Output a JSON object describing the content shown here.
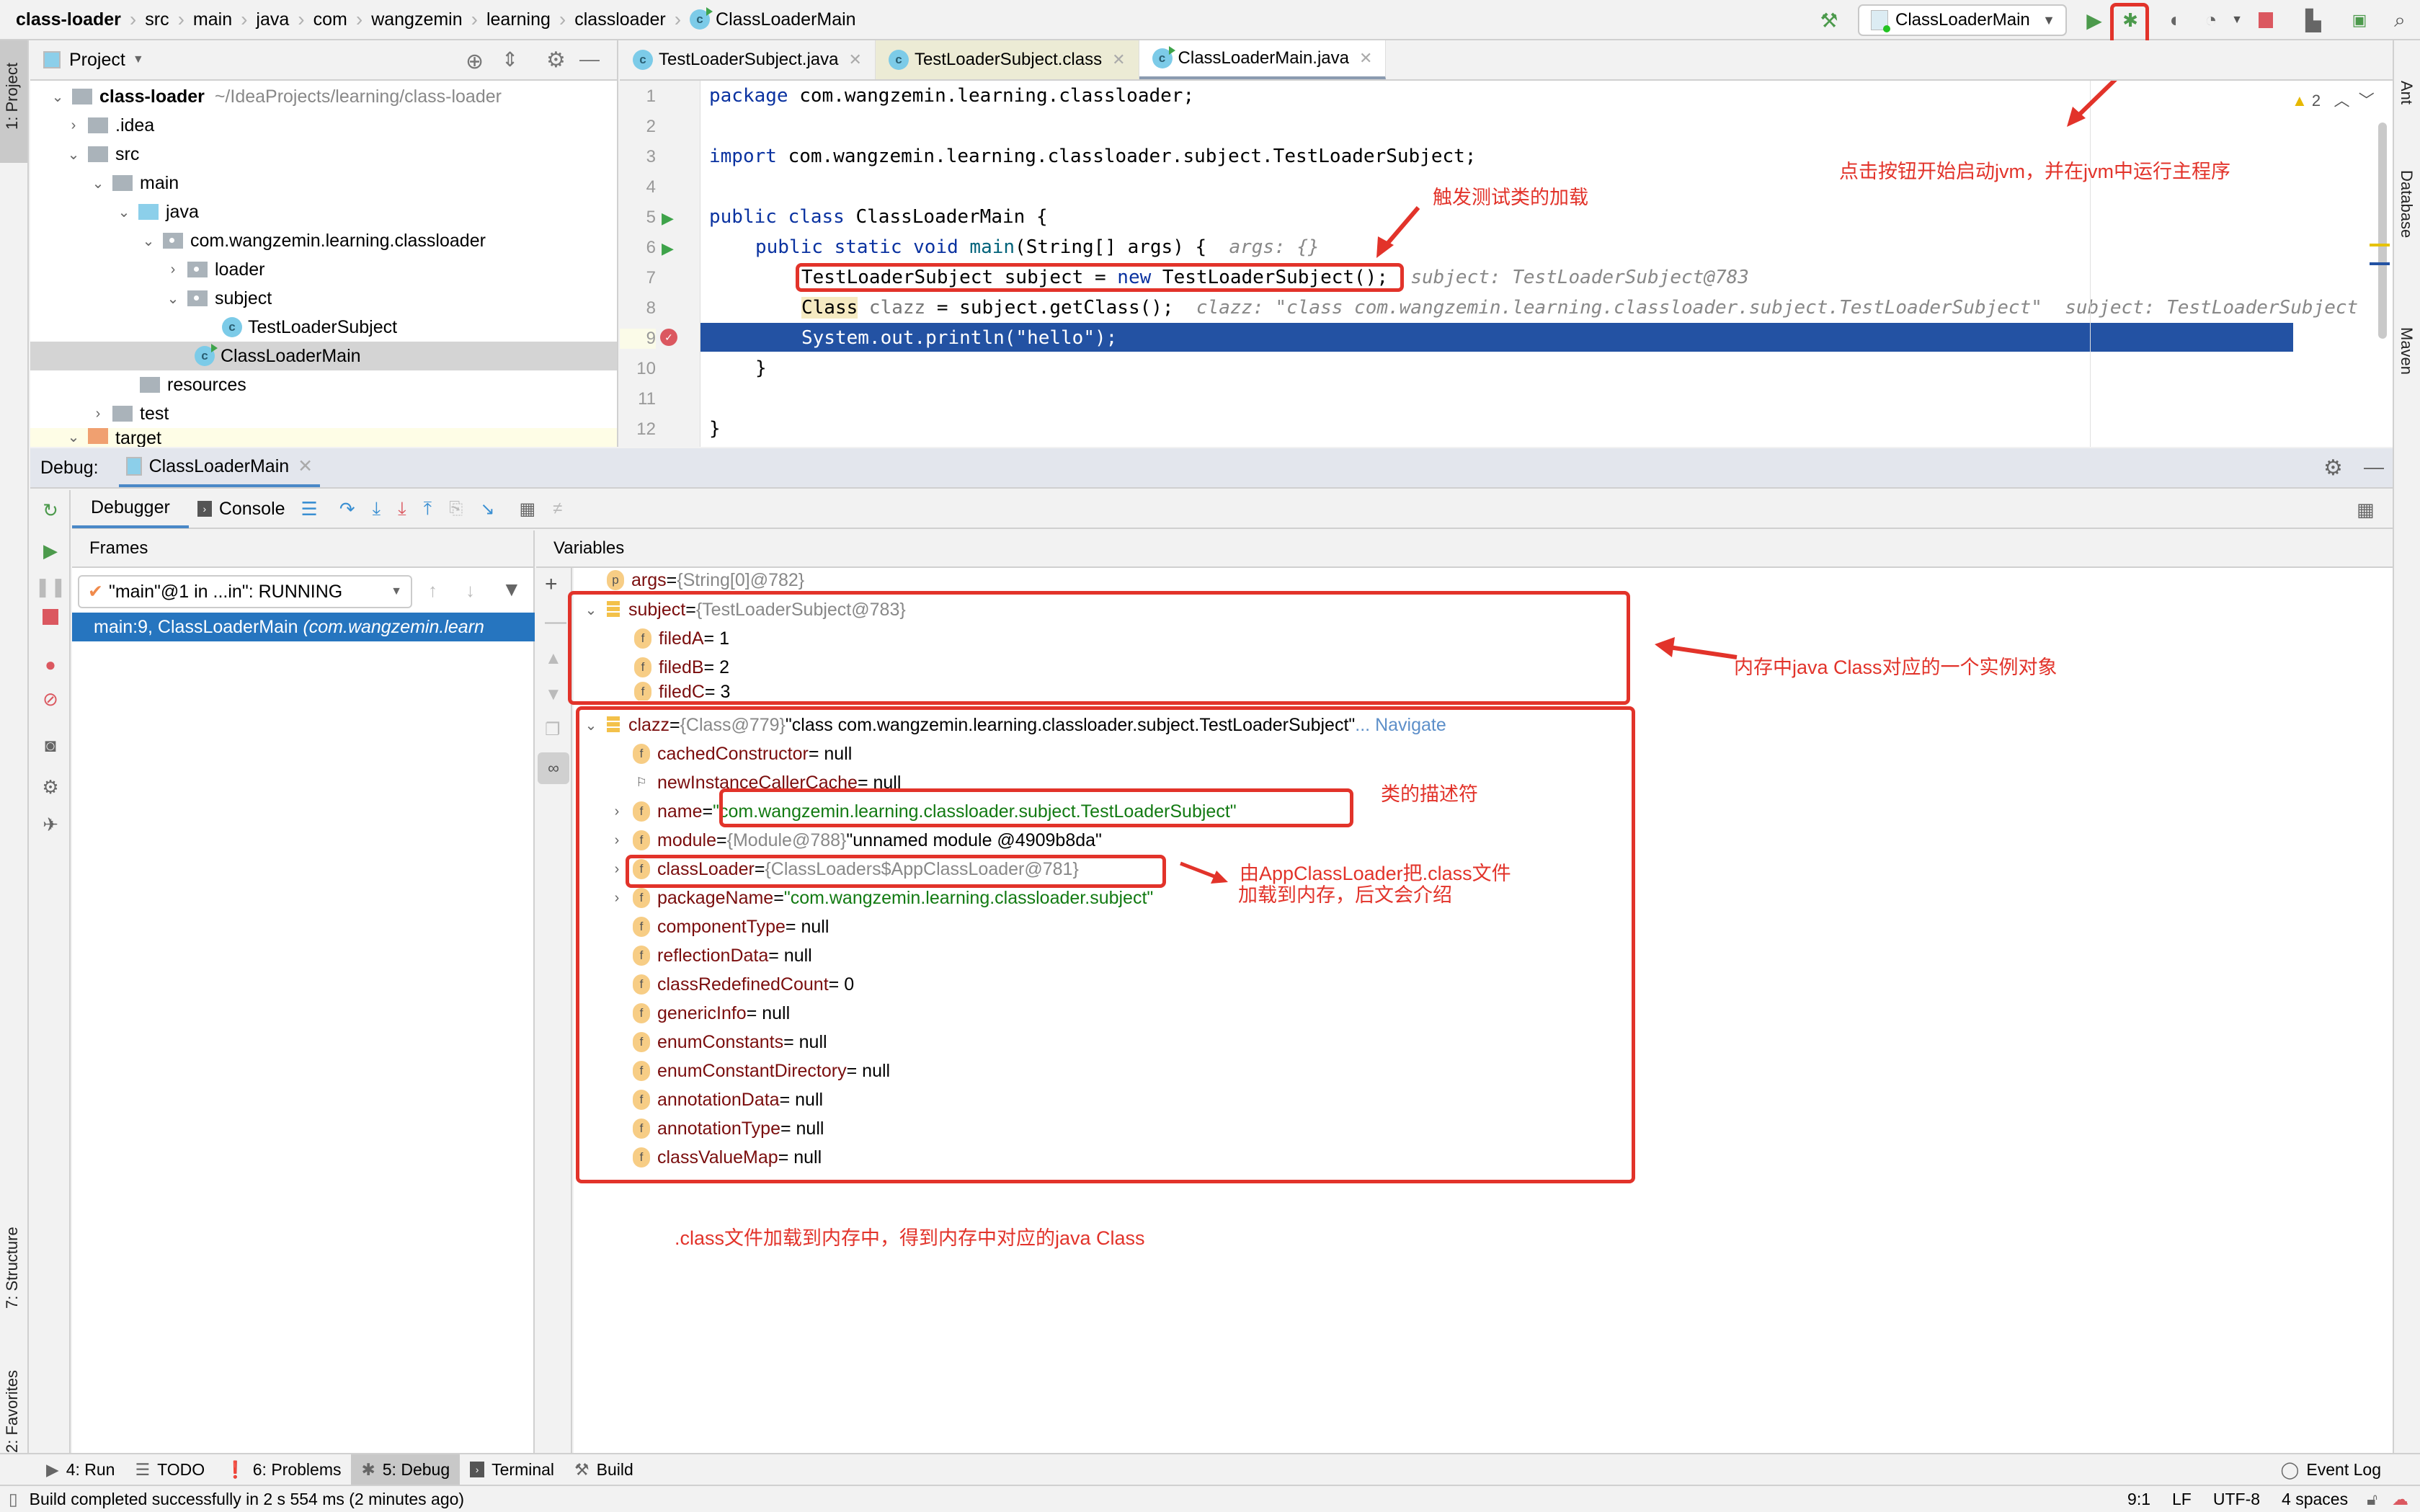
{
  "breadcrumb": [
    "class-loader",
    "src",
    "main",
    "java",
    "com",
    "wangzemin",
    "learning",
    "classloader",
    "ClassLoaderMain"
  ],
  "toolbar": {
    "run_config": "ClassLoaderMain"
  },
  "left_strip": {
    "project_tab": "1: Project",
    "structure_tab": "7: Structure",
    "favorites_tab": "2: Favorites"
  },
  "right_strip": {
    "ant": "Ant",
    "database": "Database",
    "maven": "Maven"
  },
  "project": {
    "title": "Project",
    "root_name": "class-loader",
    "root_path": "~/IdeaProjects/learning/class-loader",
    "items": [
      ".idea",
      "src",
      "main",
      "java",
      "com.wangzemin.learning.classloader",
      "loader",
      "subject",
      "TestLoaderSubject",
      "ClassLoaderMain",
      "resources",
      "test",
      "target"
    ]
  },
  "editor": {
    "tabs": [
      "TestLoaderSubject.java",
      "TestLoaderSubject.class",
      "ClassLoaderMain.java"
    ],
    "warnings": "2",
    "line_numbers": [
      "1",
      "2",
      "3",
      "4",
      "5",
      "6",
      "7",
      "8",
      "9",
      "10",
      "11",
      "12"
    ],
    "lines": {
      "l1_kw": "package",
      "l1": " com.wangzemin.learning.classloader;",
      "l3_kw": "import",
      "l3": " com.wangzemin.learning.classloader.subject.TestLoaderSubject;",
      "l5_kw": "public class",
      "l5": " ClassLoaderMain {",
      "l6_kw": "public static void",
      "l6_fn": " main",
      "l6": "(String[] args) {",
      "l6_hint": "args: {}",
      "l7_a": "TestLoaderSubject subject = ",
      "l7_kw": "new",
      "l7_b": " TestLoaderSubject();",
      "l7_hint": "subject: TestLoaderSubject@783",
      "l8_cls": "Class",
      "l8_var": " clazz",
      "l8": " = subject.getClass();",
      "l8_hint": "clazz: \"class com.wangzemin.learning.classloader.subject.TestLoaderSubject\"",
      "l8_hint2": "subject: TestLoaderSubject",
      "l9": "System.out.println(\"hello\");",
      "l10": "}",
      "l12": "}"
    }
  },
  "debug": {
    "label": "Debug:",
    "session": "ClassLoaderMain",
    "tabs": {
      "debugger": "Debugger",
      "console": "Console"
    },
    "frames_title": "Frames",
    "variables_title": "Variables",
    "thread": "\"main\"@1 in ...in\": RUNNING",
    "frame": "main:9, ClassLoaderMain",
    "frame_pkg": "(com.wangzemin.learn",
    "variables": {
      "args": {
        "name": "args",
        "eq": " = ",
        "ref": "{String[0]@782}"
      },
      "subject": {
        "name": "subject",
        "eq": " = ",
        "ref": "{TestLoaderSubject@783}"
      },
      "filedA": {
        "name": "filedA",
        "val": " = 1"
      },
      "filedB": {
        "name": "filedB",
        "val": " = 2"
      },
      "filedC": {
        "name": "filedC",
        "val": " = 3"
      },
      "clazz": {
        "name": "clazz",
        "eq": " = ",
        "ref": "{Class@779}",
        "val": " \"class com.wangzemin.learning.classloader.subject.TestLoaderSubject\"",
        "link": " ... Navigate"
      },
      "fields": [
        {
          "name": "cachedConstructor",
          "val": " = null"
        },
        {
          "name": "newInstanceCallerCache",
          "val": " = null"
        },
        {
          "name": "name",
          "eq": " = ",
          "str": "\"com.wangzemin.learning.classloader.subject.TestLoaderSubject\""
        },
        {
          "name": "module",
          "eq": " = ",
          "ref": "{Module@788}",
          "val": " \"unnamed module @4909b8da\""
        },
        {
          "name": "classLoader",
          "eq": " = ",
          "ref": "{ClassLoaders$AppClassLoader@781}"
        },
        {
          "name": "packageName",
          "eq": " = ",
          "str": "\"com.wangzemin.learning.classloader.subject\""
        },
        {
          "name": "componentType",
          "val": " = null"
        },
        {
          "name": "reflectionData",
          "val": " = null"
        },
        {
          "name": "classRedefinedCount",
          "val": " = 0"
        },
        {
          "name": "genericInfo",
          "val": " = null"
        },
        {
          "name": "enumConstants",
          "val": " = null"
        },
        {
          "name": "enumConstantDirectory",
          "val": " = null"
        },
        {
          "name": "annotationData",
          "val": " = null"
        },
        {
          "name": "annotationType",
          "val": " = null"
        },
        {
          "name": "classValueMap",
          "val": " = null"
        }
      ]
    }
  },
  "annotations": {
    "start_jvm": "点击按钮开始启动jvm，并在jvm中运行主程序",
    "trigger_load": "触发测试类的加载",
    "instance": "内存中java Class对应的一个实例对象",
    "descriptor": "类的描述符",
    "classloader_1": "由AppClassLoader把.class文件",
    "classloader_2": "加载到内存，后文会介绍",
    "summary": ".class文件加载到内存中，得到内存中对应的java Class"
  },
  "tool_windows": [
    {
      "label": "4: Run"
    },
    {
      "label": "TODO"
    },
    {
      "label": "6: Problems"
    },
    {
      "label": "5: Debug"
    },
    {
      "label": "Terminal"
    },
    {
      "label": "Build"
    }
  ],
  "event_log": "Event Log",
  "status": {
    "message": "Build completed successfully in 2 s 554 ms (2 minutes ago)",
    "position": "9:1",
    "line_sep": "LF",
    "encoding": "UTF-8",
    "indent": "4 spaces"
  }
}
